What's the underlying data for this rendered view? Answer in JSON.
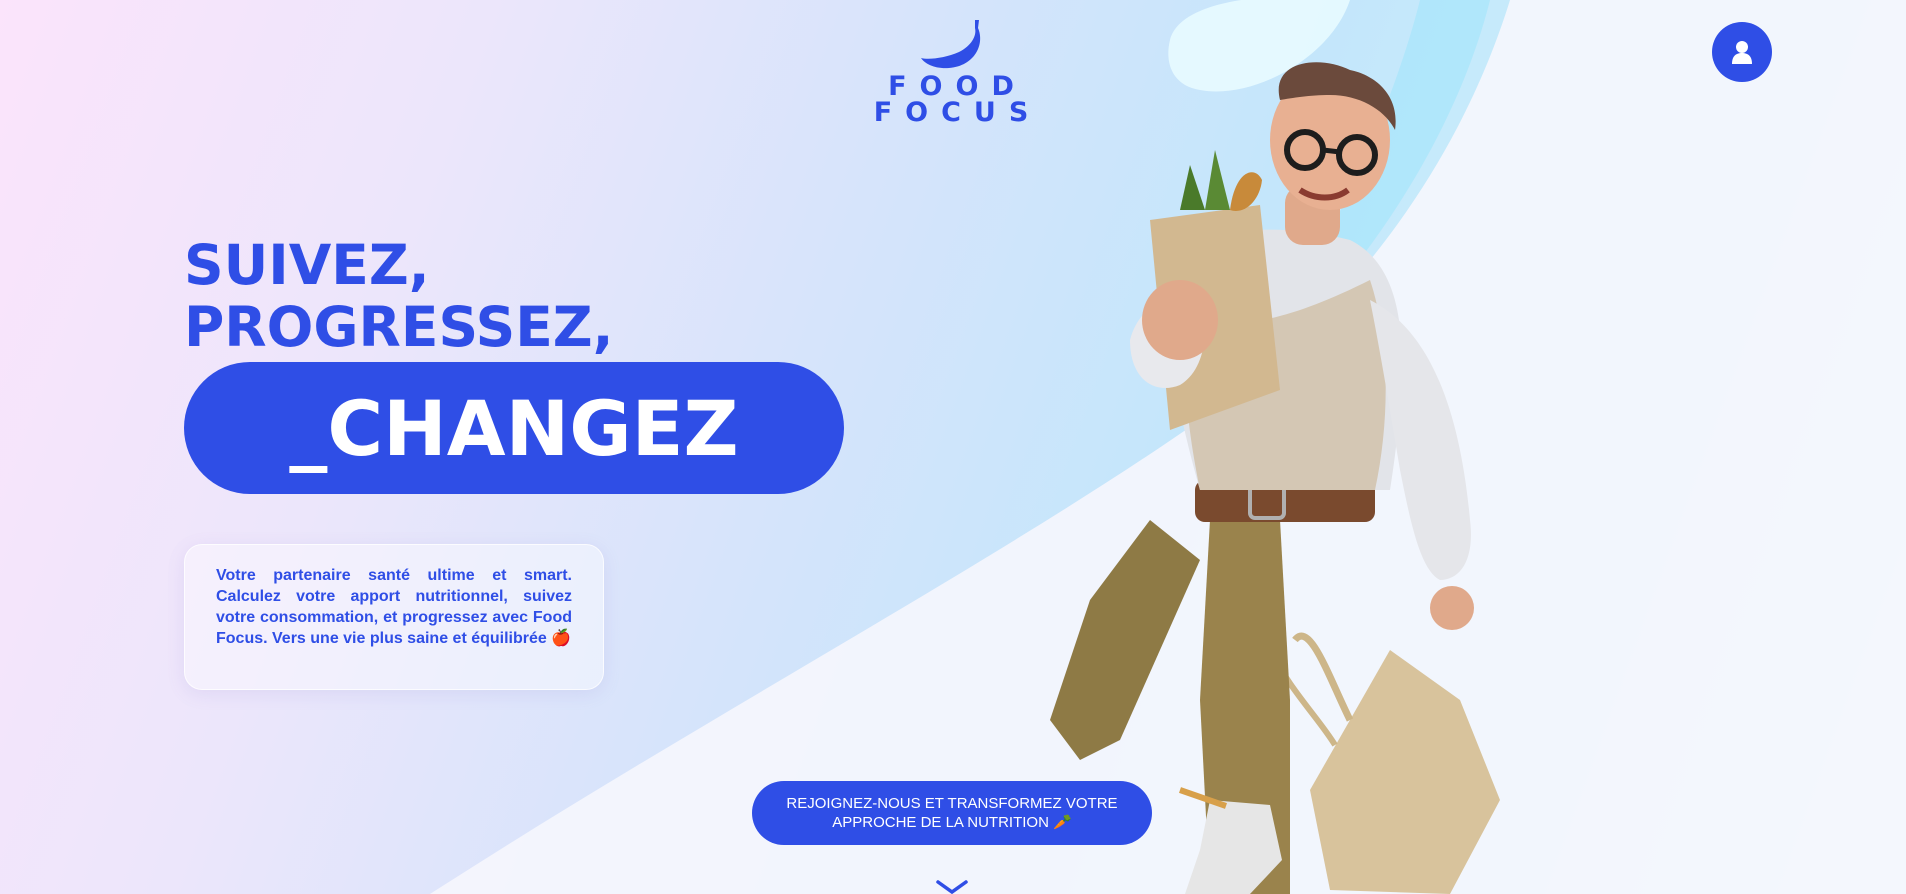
{
  "brand": {
    "logo_icon": "banana-icon",
    "name_line1": "FOOD",
    "name_line2": "FOCUS",
    "accent_color": "#2f4ee6"
  },
  "header": {
    "account_icon": "user-icon"
  },
  "hero": {
    "title_line1": "SUIVEZ,",
    "title_line2": "PROGRESSEZ,",
    "highlight": "_CHANGEZ",
    "description": "Votre partenaire santé ultime et smart. Calculez votre apport nutritionnel, suivez votre consommation, et progressez avec Food Focus. Vers une vie plus saine et équilibrée",
    "description_emoji": "🍎",
    "illustration": "man-with-grocery-bags-illustration"
  },
  "cta": {
    "label": "REJOIGNEZ-NOUS ET TRANSFORMEZ VOTRE APPROCHE DE LA NUTRITION",
    "emoji": "🥕"
  },
  "scroll": {
    "icon": "chevron-down-icon"
  }
}
